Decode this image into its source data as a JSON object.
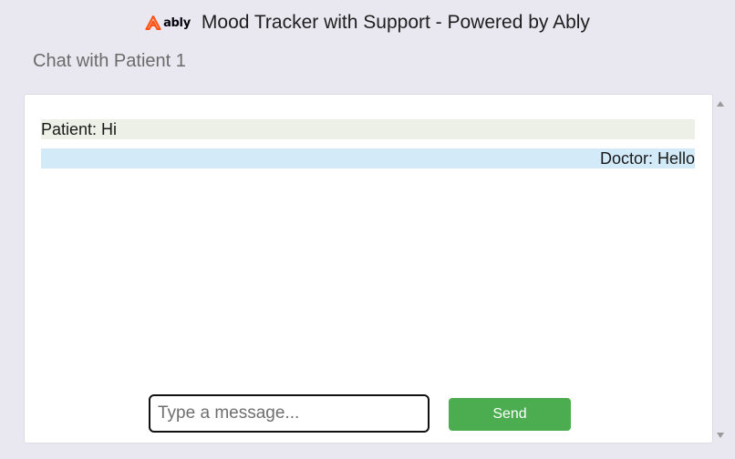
{
  "header": {
    "logo_text": "ably",
    "title": "Mood Tracker with Support - Powered by Ably"
  },
  "chat": {
    "heading": "Chat with Patient 1",
    "messages": [
      {
        "sender": "patient",
        "text": "Patient: Hi"
      },
      {
        "sender": "doctor",
        "text": "Doctor: Hello"
      }
    ]
  },
  "composer": {
    "placeholder": "Type a message...",
    "value": "",
    "send_label": "Send"
  },
  "colors": {
    "brand_accent": "#ff5416",
    "send_button": "#4cad50",
    "patient_bubble": "#ecf0e6",
    "doctor_bubble": "#d3ebf8"
  }
}
